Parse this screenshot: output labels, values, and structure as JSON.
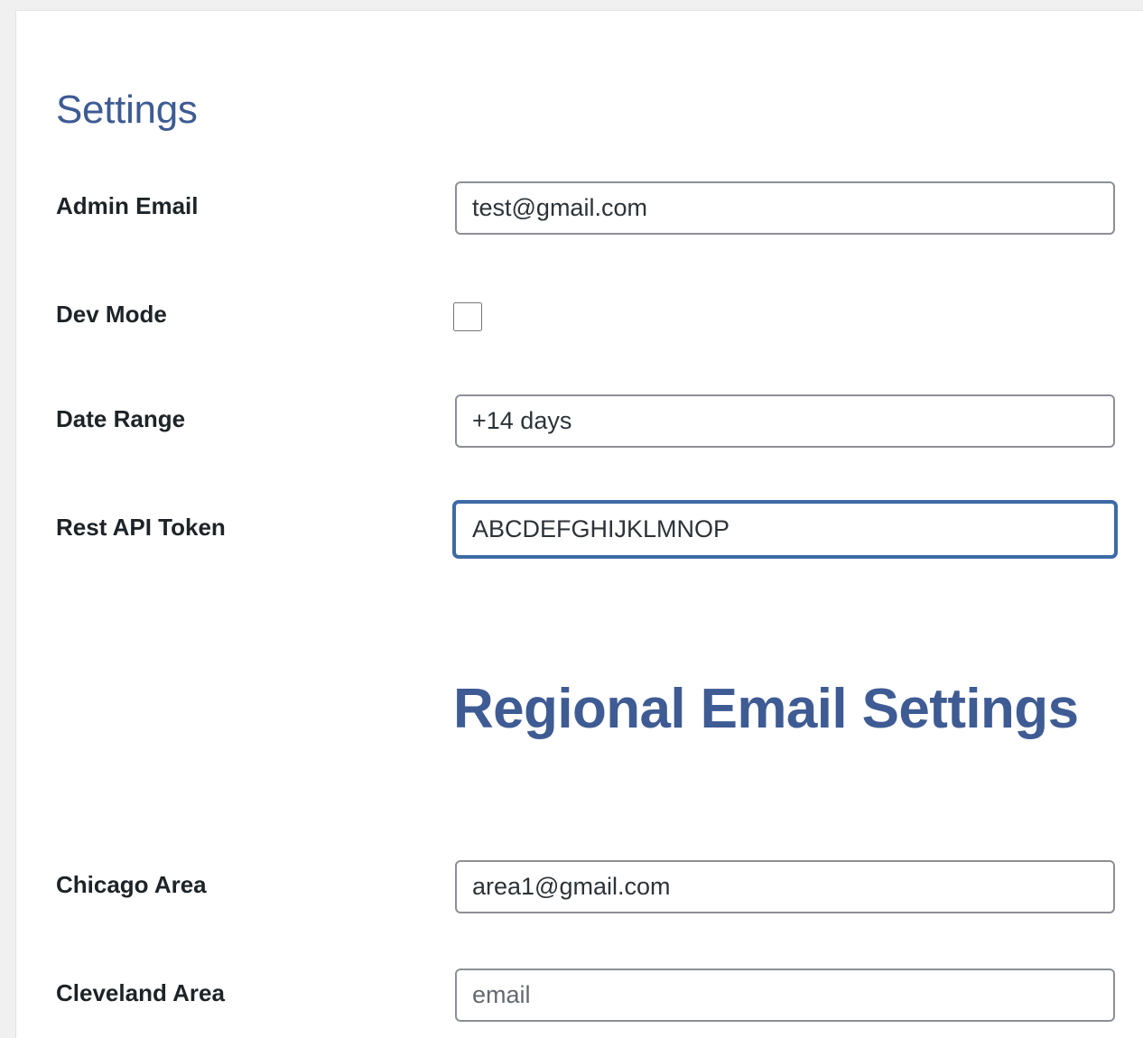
{
  "page": {
    "title": "Settings"
  },
  "settings": {
    "admin_email_label": "Admin Email",
    "admin_email_value": "test@gmail.com",
    "dev_mode_label": "Dev Mode",
    "dev_mode_checked": false,
    "date_range_label": "Date Range",
    "date_range_value": "+14 days",
    "rest_api_token_label": "Rest API Token",
    "rest_api_token_value": "ABCDEFGHIJKLMNOP"
  },
  "regional": {
    "section_title": "Regional Email Settings",
    "chicago_label": "Chicago Area",
    "chicago_value": "area1@gmail.com",
    "cleveland_label": "Cleveland Area",
    "cleveland_value": "",
    "cleveland_placeholder": "email"
  },
  "colors": {
    "heading": "#3e5b93",
    "focus_border": "#3c6aa5",
    "input_border": "#8c8f94",
    "label_text": "#1d2327"
  }
}
